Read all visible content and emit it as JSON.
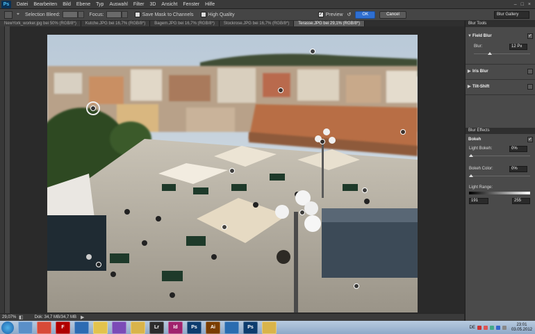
{
  "app": {
    "logo": "Ps"
  },
  "menu": [
    "Datei",
    "Bearbeiten",
    "Bild",
    "Ebene",
    "Typ",
    "Auswahl",
    "Filter",
    "3D",
    "Ansicht",
    "Fenster",
    "Hilfe"
  ],
  "window_controls": [
    "–",
    "□",
    "×"
  ],
  "options": {
    "selection_bleed_label": "Selection Bleed:",
    "focus_label": "Focus:",
    "save_mask_label": "Save Mask to Channels",
    "high_quality_label": "High Quality",
    "preview_label": "Preview",
    "ok_label": "OK",
    "cancel_label": "Cancel",
    "workspace": "Blur Gallery"
  },
  "tabs": [
    "NewYork_worker.jpg bei 50% (RGB/8*)",
    "Kutche.JPG bei 16,7% (RGB/8*)",
    "Bagem.JPG bei 16,7% (RGB/8*)",
    "Stockrose.JPG bei 16,7% (RGB/8*)",
    "Terasse.JPG bei 29,1% (RGB/8*)"
  ],
  "active_tab": 4,
  "status": {
    "zoom": "29,07%",
    "doc": "Dok: 34,7 MB/34,7 MB"
  },
  "blur_tools": {
    "header": "Blur Tools",
    "field_blur": {
      "label": "Field Blur",
      "blur_label": "Blur:",
      "blur_value": "12 Px",
      "blur_level": 0.25
    },
    "iris_blur": "Iris Blur",
    "tilt_shift": "Tilt-Shift"
  },
  "blur_effects": {
    "header": "Blur Effects",
    "bokeh": "Bokeh",
    "light_bokeh_label": "Light Bokeh:",
    "light_bokeh_value": "0%",
    "bokeh_color_label": "Bokeh Color:",
    "bokeh_color_value": "0%",
    "light_range_label": "Light Range:",
    "light_range_low": "191",
    "light_range_high": "255"
  },
  "taskbar": {
    "apps": [
      {
        "icon": "explorer-icon",
        "color": "#5a8fc8",
        "glyph": ""
      },
      {
        "icon": "chrome-icon",
        "color": "#d84a38",
        "glyph": ""
      },
      {
        "icon": "filezilla-icon",
        "color": "#b00000",
        "glyph": "F"
      },
      {
        "icon": "thunderbird-icon",
        "color": "#2c6bb3",
        "glyph": ""
      },
      {
        "icon": "notes-icon",
        "color": "#e3c34d",
        "glyph": ""
      },
      {
        "icon": "purple-app-icon",
        "color": "#7b4bb7",
        "glyph": ""
      },
      {
        "icon": "folder-icon",
        "color": "#d9b44a",
        "glyph": ""
      },
      {
        "icon": "lightroom-icon",
        "color": "#2c2c2c",
        "glyph": "Lr"
      },
      {
        "icon": "indesign-icon",
        "color": "#a0226d",
        "glyph": "Id"
      },
      {
        "icon": "photoshop-icon",
        "color": "#0d3c6e",
        "glyph": "Ps"
      },
      {
        "icon": "illustrator-icon",
        "color": "#7a3d00",
        "glyph": "Ai"
      },
      {
        "icon": "network-icon",
        "color": "#2a6cb0",
        "glyph": ""
      },
      {
        "icon": "photoshop-active-icon",
        "color": "#0d3c6e",
        "glyph": "Ps"
      },
      {
        "icon": "explorer2-icon",
        "color": "#d9b44a",
        "glyph": ""
      }
    ],
    "lang": "DE",
    "time": "23:01",
    "date": "03.05.2012"
  }
}
